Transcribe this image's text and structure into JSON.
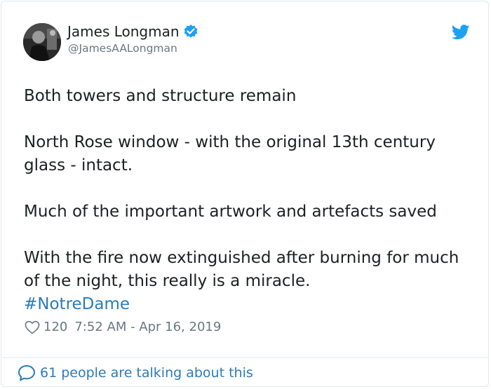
{
  "author": {
    "display_name": "James Longman",
    "handle": "@JamesAALongman",
    "avatar_icon": "profile-photo",
    "verified_icon": "verified-badge-icon"
  },
  "tweet": {
    "lines": [
      "Both towers and structure remain",
      "",
      "North Rose window - with the original 13th century glass - intact.",
      "",
      "Much of the important artwork and artefacts saved",
      "",
      "With the fire now extinguished after burning for much of the night, this really is a miracle."
    ],
    "hashtag": "#NotreDame"
  },
  "meta": {
    "likes": "120",
    "timestamp": "7:52 AM - Apr 16, 2019"
  },
  "footer": {
    "talking": "61 people are talking about this"
  },
  "colors": {
    "accent": "#2b7bb9",
    "twitter_blue": "#1da1f2",
    "secondary_text": "#697882"
  }
}
